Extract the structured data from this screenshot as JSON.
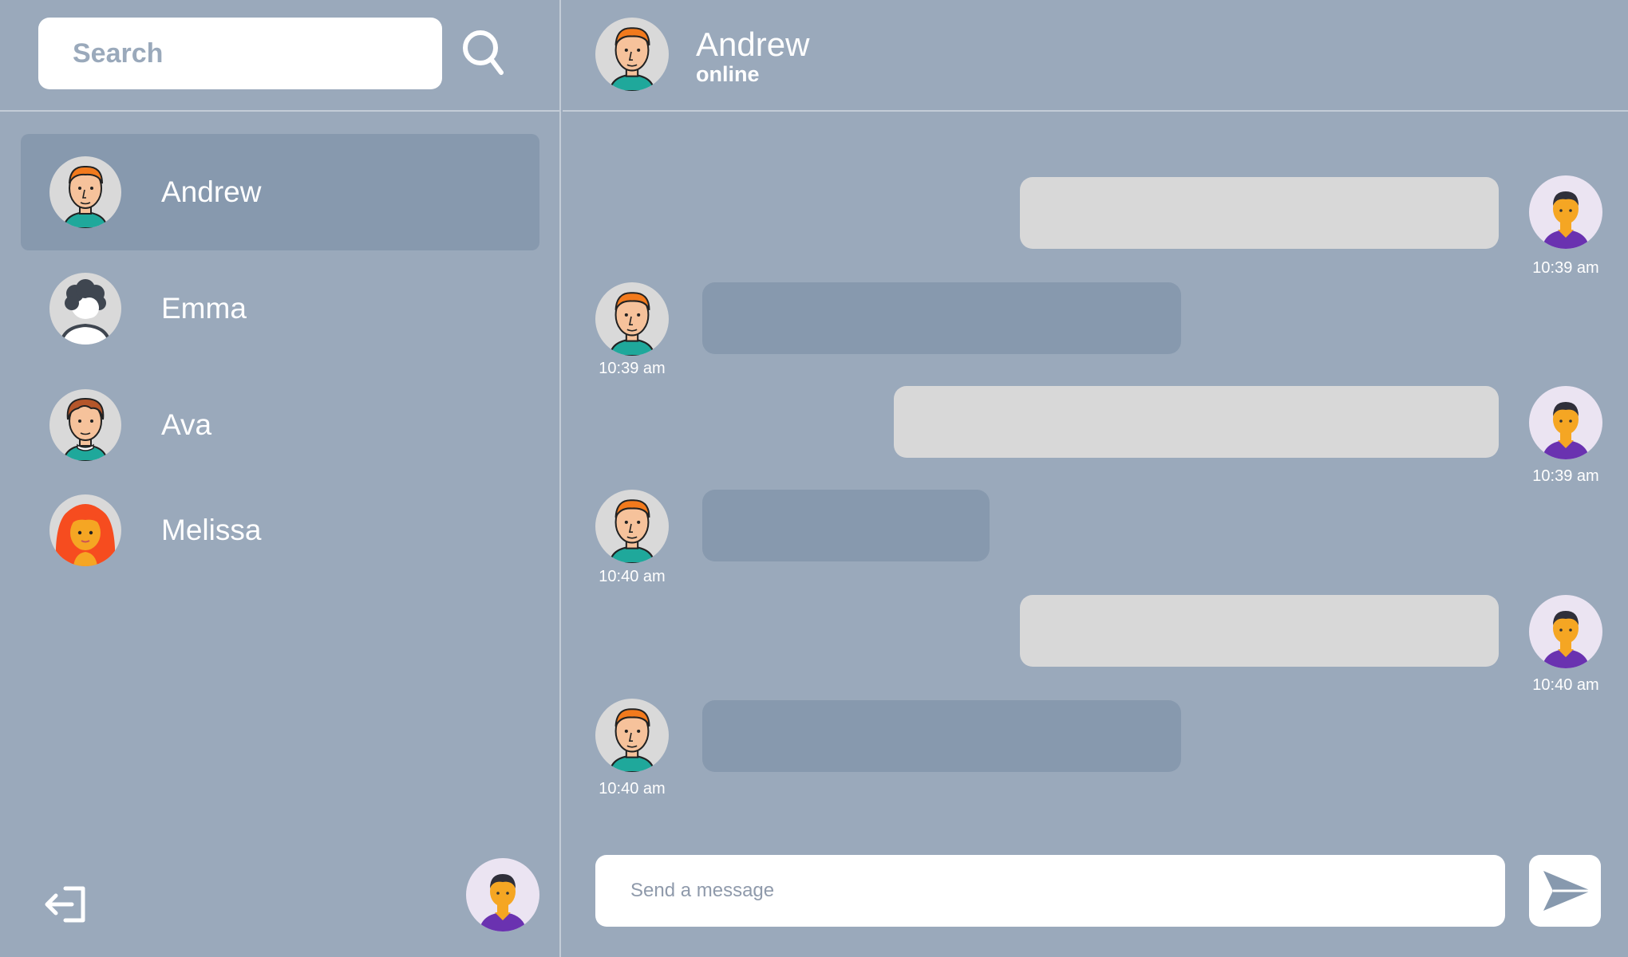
{
  "search": {
    "placeholder": "Search",
    "icon": "search-icon"
  },
  "contacts": [
    {
      "name": "Andrew",
      "avatar": "andrew-avatar",
      "active": true
    },
    {
      "name": "Emma",
      "avatar": "emma-avatar",
      "active": false
    },
    {
      "name": "Ava",
      "avatar": "ava-avatar",
      "active": false
    },
    {
      "name": "Melissa",
      "avatar": "melissa-avatar",
      "active": false
    }
  ],
  "chat": {
    "name": "Andrew",
    "status": "online",
    "messages": [
      {
        "direction": "out",
        "time": "10:39 am"
      },
      {
        "direction": "in",
        "time": "10:39 am"
      },
      {
        "direction": "out",
        "time": "10:39 am"
      },
      {
        "direction": "in",
        "time": "10:40 am"
      },
      {
        "direction": "out",
        "time": "10:40 am"
      },
      {
        "direction": "in",
        "time": "10:40 am"
      }
    ]
  },
  "composer": {
    "placeholder": "Send a message",
    "send_icon": "send-icon"
  },
  "footer": {
    "logout_icon": "logout-icon"
  },
  "colors": {
    "background": "#9aa9bb",
    "active_row": "#8799ae",
    "incoming_bubble": "#8799ae",
    "outgoing_bubble": "#d8d8d8"
  }
}
